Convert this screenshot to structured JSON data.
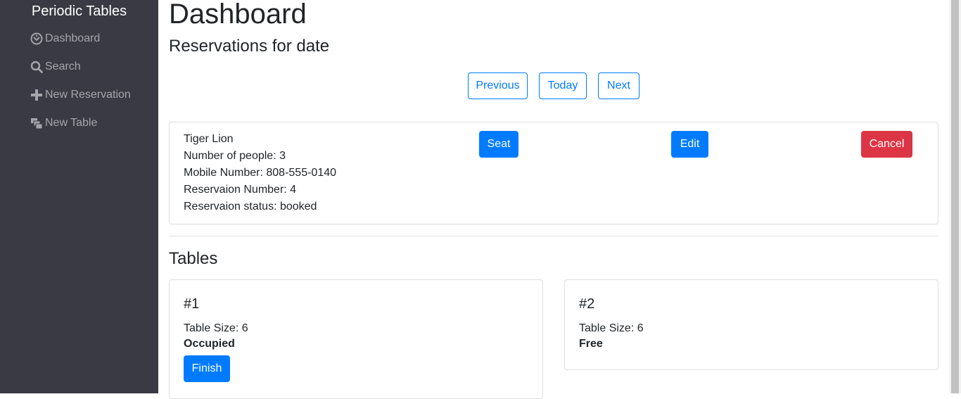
{
  "sidebar": {
    "brand": "Periodic Tables",
    "items": [
      {
        "label": "Dashboard",
        "icon": "dashboard-icon"
      },
      {
        "label": "Search",
        "icon": "search-icon"
      },
      {
        "label": "New Reservation",
        "icon": "plus-icon"
      },
      {
        "label": "New Table",
        "icon": "layers-icon"
      }
    ]
  },
  "main": {
    "title": "Dashboard",
    "subtitle": "Reservations for date",
    "date_nav": {
      "previous": "Previous",
      "today": "Today",
      "next": "Next"
    },
    "reservation": {
      "name": "Tiger Lion",
      "people": "Number of people: 3",
      "mobile": "Mobile Number: 808-555-0140",
      "number": "Reservaion Number: 4",
      "status": "Reservaion status: booked",
      "seat_label": "Seat",
      "edit_label": "Edit",
      "cancel_label": "Cancel"
    },
    "tables_title": "Tables",
    "tables": [
      {
        "name": "#1",
        "size": "Table Size: 6",
        "status": "Occupied",
        "finish_label": "Finish"
      },
      {
        "name": "#2",
        "size": "Table Size: 6",
        "status": "Free"
      }
    ]
  },
  "colors": {
    "sidebar_bg": "#3a3a44",
    "primary": "#007bff",
    "danger": "#dc3545"
  }
}
